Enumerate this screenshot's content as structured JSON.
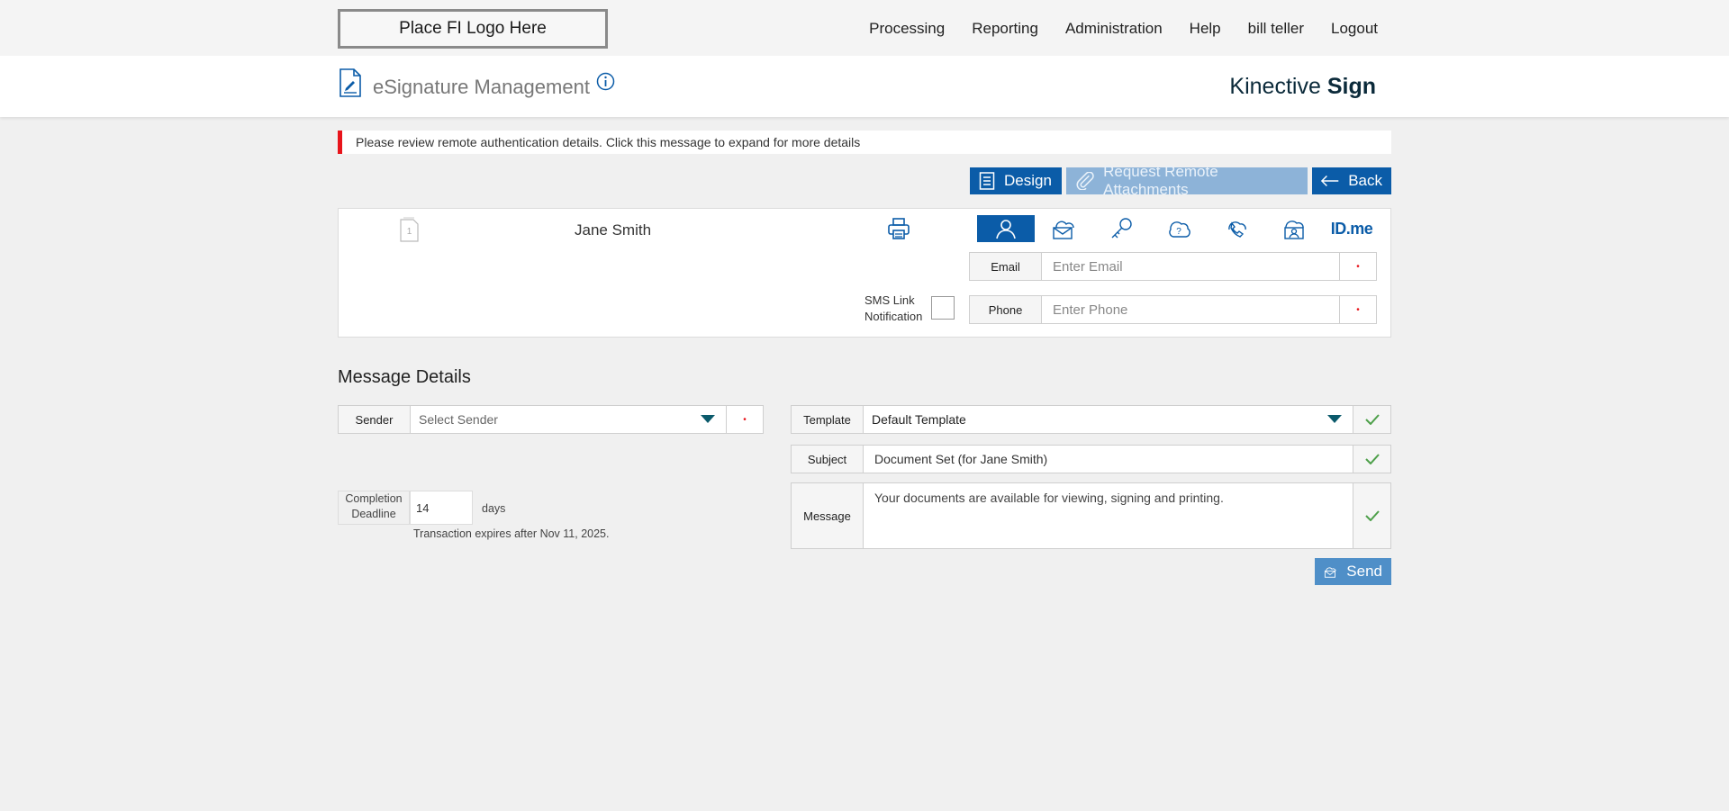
{
  "header": {
    "logo_text": "Place FI Logo Here",
    "nav": [
      "Processing",
      "Reporting",
      "Administration",
      "Help",
      "bill teller",
      "Logout"
    ]
  },
  "titlebar": {
    "title": "eSignature Management",
    "brand_prefix": "Kinective",
    "brand_suffix": "Sign"
  },
  "alert": {
    "text": "Please review remote authentication details. Click this message to expand for more details"
  },
  "actions": {
    "design": "Design",
    "request": "Request Remote Attachments",
    "back": "Back"
  },
  "signer": {
    "doc_number": "1",
    "name": "Jane Smith",
    "auth_tabs": [
      "person",
      "email",
      "key",
      "question-shield",
      "phone",
      "id-card",
      "idme"
    ],
    "idme_label": "ID.me",
    "email_label": "Email",
    "email_placeholder": "Enter Email",
    "phone_label": "Phone",
    "phone_placeholder": "Enter Phone",
    "sms_label_line1": "SMS Link",
    "sms_label_line2": "Notification"
  },
  "message_details": {
    "title": "Message Details",
    "sender_label": "Sender",
    "sender_value": "Select Sender",
    "template_label": "Template",
    "template_value": "Default Template",
    "subject_label": "Subject",
    "subject_value": "Document Set (for Jane Smith)",
    "message_label": "Message",
    "message_value": "Your documents are available for viewing, signing and printing.",
    "deadline_label_line1": "Completion",
    "deadline_label_line2": "Deadline",
    "deadline_value": "14",
    "deadline_unit": "days",
    "expires_text": "Transaction expires after Nov 11, 2025.",
    "send": "Send"
  },
  "colors": {
    "primary": "#0b5ca8",
    "alert": "#e8141b",
    "ok": "#4ea04a"
  }
}
